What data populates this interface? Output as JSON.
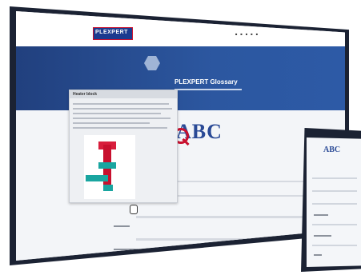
{
  "header": {
    "logo_text": "PLEXPERT"
  },
  "hero": {
    "title": "PLEXPERT Glossary"
  },
  "main": {
    "abc_heading": "ABC"
  },
  "popup": {
    "title": "Heater block"
  },
  "tablet": {
    "abc_heading": "ABC"
  },
  "colors": {
    "navy": "#1b3a8f",
    "hero_blue": "#2c57a0",
    "brand_red": "#c8102e",
    "teal": "#19a5a0"
  }
}
